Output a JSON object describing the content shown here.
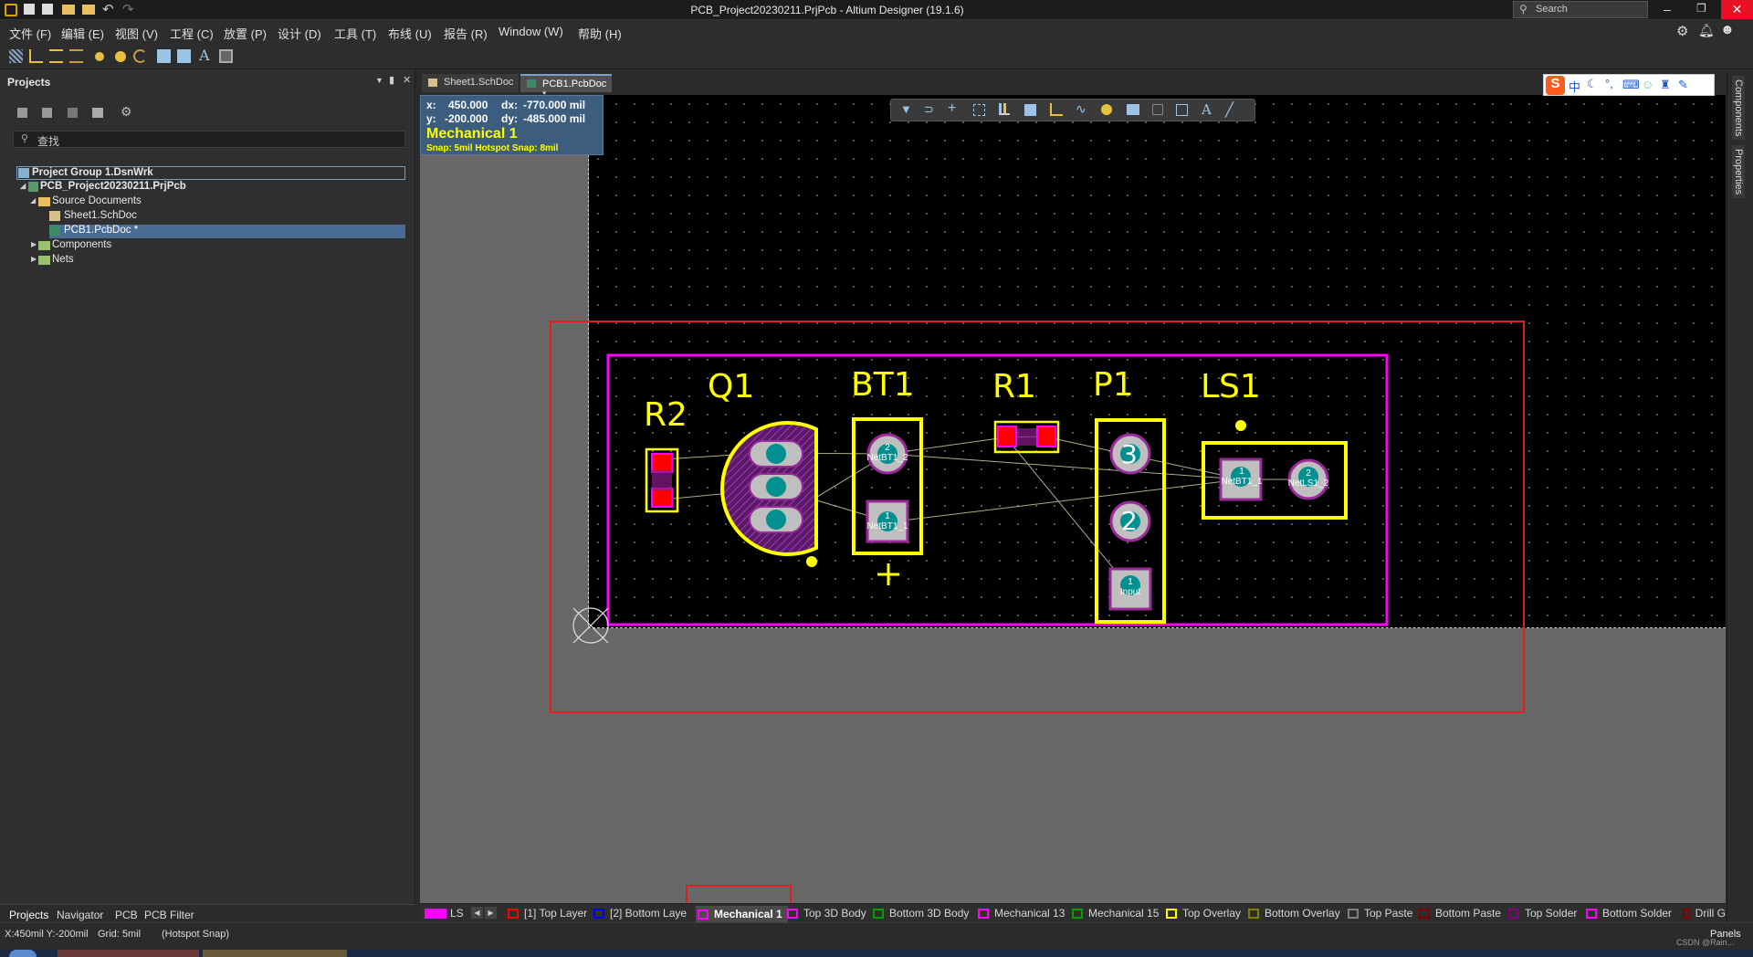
{
  "window": {
    "title": "PCB_Project20230211.PrjPcb - Altium Designer (19.1.6)",
    "search_placeholder": "Search"
  },
  "menu": [
    "文件 (F)",
    "编辑 (E)",
    "视图 (V)",
    "工程 (C)",
    "放置 (P)",
    "设计 (D)",
    "工具 (T)",
    "布线 (U)",
    "报告 (R)",
    "Window (W)",
    "帮助 (H)"
  ],
  "projects_panel": {
    "title": "Projects",
    "search_placeholder": "查找",
    "tree": {
      "group": "Project Group 1.DsnWrk",
      "project": "PCB_Project20230211.PrjPcb",
      "source": "Source Documents",
      "sch": "Sheet1.SchDoc",
      "pcb": "PCB1.PcbDoc *",
      "components": "Components",
      "nets": "Nets"
    },
    "bottom_tabs": [
      "Projects",
      "Navigator",
      "PCB",
      "PCB Filter"
    ]
  },
  "doc_tabs": [
    "Sheet1.SchDoc",
    "PCB1.PcbDoc *"
  ],
  "hud": {
    "x_label": "x:",
    "x": "450.000",
    "dx_label": "dx:",
    "dx": "-770.000 mil",
    "y_label": "y:",
    "y": "-200.000",
    "dy_label": "dy:",
    "dy": "-485.000 mil",
    "layer": "Mechanical 1",
    "snap": "Snap: 5mil Hotspot Snap: 8mil"
  },
  "components": {
    "r2": "R2",
    "q1": "Q1",
    "bt1": "BT1",
    "r1": "R1",
    "p1": "P1",
    "ls1": "LS1"
  },
  "pads": {
    "bt1_2_num": "2",
    "bt1_2_net": "NetBT1_2",
    "bt1_1_num": "1",
    "bt1_1_net": "NetBT1_1",
    "p1_3": "3",
    "p1_2": "2",
    "p1_1_num": "1",
    "p1_1_net": "Input",
    "ls1_1_num": "1",
    "ls1_1_net": "NetBT1_1",
    "ls1_2_num": "2",
    "ls1_2_net": "NetLS1_2"
  },
  "layers": {
    "ls": "LS",
    "top_layer": "[1] Top Layer",
    "bottom_layer": "[2] Bottom Laye",
    "mech1": "Mechanical 1",
    "top3d": "Top 3D Body",
    "bottom3d": "Bottom 3D Body",
    "mech13": "Mechanical 13",
    "mech15": "Mechanical 15",
    "top_overlay": "Top Overlay",
    "bottom_overlay": "Bottom Overlay",
    "top_paste": "Top Paste",
    "bottom_paste": "Bottom Paste",
    "top_solder": "Top Solder",
    "bottom_solder": "Bottom Solder",
    "drill": "Drill G"
  },
  "colors": {
    "top_layer": "#ff0000",
    "bottom_layer": "#0000ff",
    "mech1": "#ff00ff",
    "top3d": "#ff00ff",
    "bottom3d": "#00a000",
    "mech13": "#ff00ff",
    "mech15": "#00a000",
    "top_overlay": "#ffff00",
    "bottom_overlay": "#808000",
    "top_paste": "#808080",
    "bottom_paste": "#800000",
    "top_solder": "#800080",
    "bottom_solder": "#ff00ff",
    "drill": "#800000"
  },
  "right_tabs": [
    "Components",
    "Properties"
  ],
  "status": {
    "coords": "X:450mil Y:-200mil",
    "grid": "Grid: 5mil",
    "snap": "(Hotspot Snap)",
    "panels": "Panels",
    "watermark": "CSDN @Rain..."
  }
}
